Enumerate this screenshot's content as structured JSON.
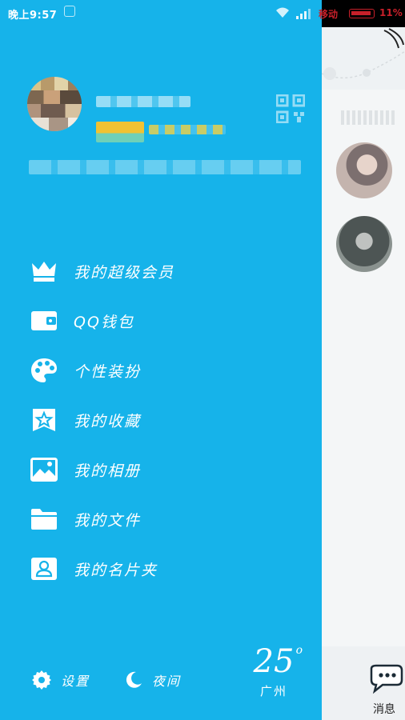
{
  "status_bar": {
    "time": "晚上9:57",
    "carrier": "移动",
    "battery": "11%"
  },
  "profile": {
    "nickname": "",
    "signature": ""
  },
  "menu": [
    {
      "label": "我的超级会员",
      "icon": "crown-icon"
    },
    {
      "label": "QQ钱包",
      "icon": "wallet-icon"
    },
    {
      "label": "个性装扮",
      "icon": "palette-icon"
    },
    {
      "label": "我的收藏",
      "icon": "star-bookmark-icon"
    },
    {
      "label": "我的相册",
      "icon": "photo-icon"
    },
    {
      "label": "我的文件",
      "icon": "folder-icon"
    },
    {
      "label": "我的名片夹",
      "icon": "contact-card-icon"
    }
  ],
  "bottom": {
    "settings_label": "设置",
    "night_label": "夜间",
    "temperature": "25",
    "city": "广州"
  },
  "peek": {
    "messages_label": "消息"
  },
  "colors": {
    "drawer_bg": "#16b3ea",
    "status_carrier": "#c8202a"
  }
}
